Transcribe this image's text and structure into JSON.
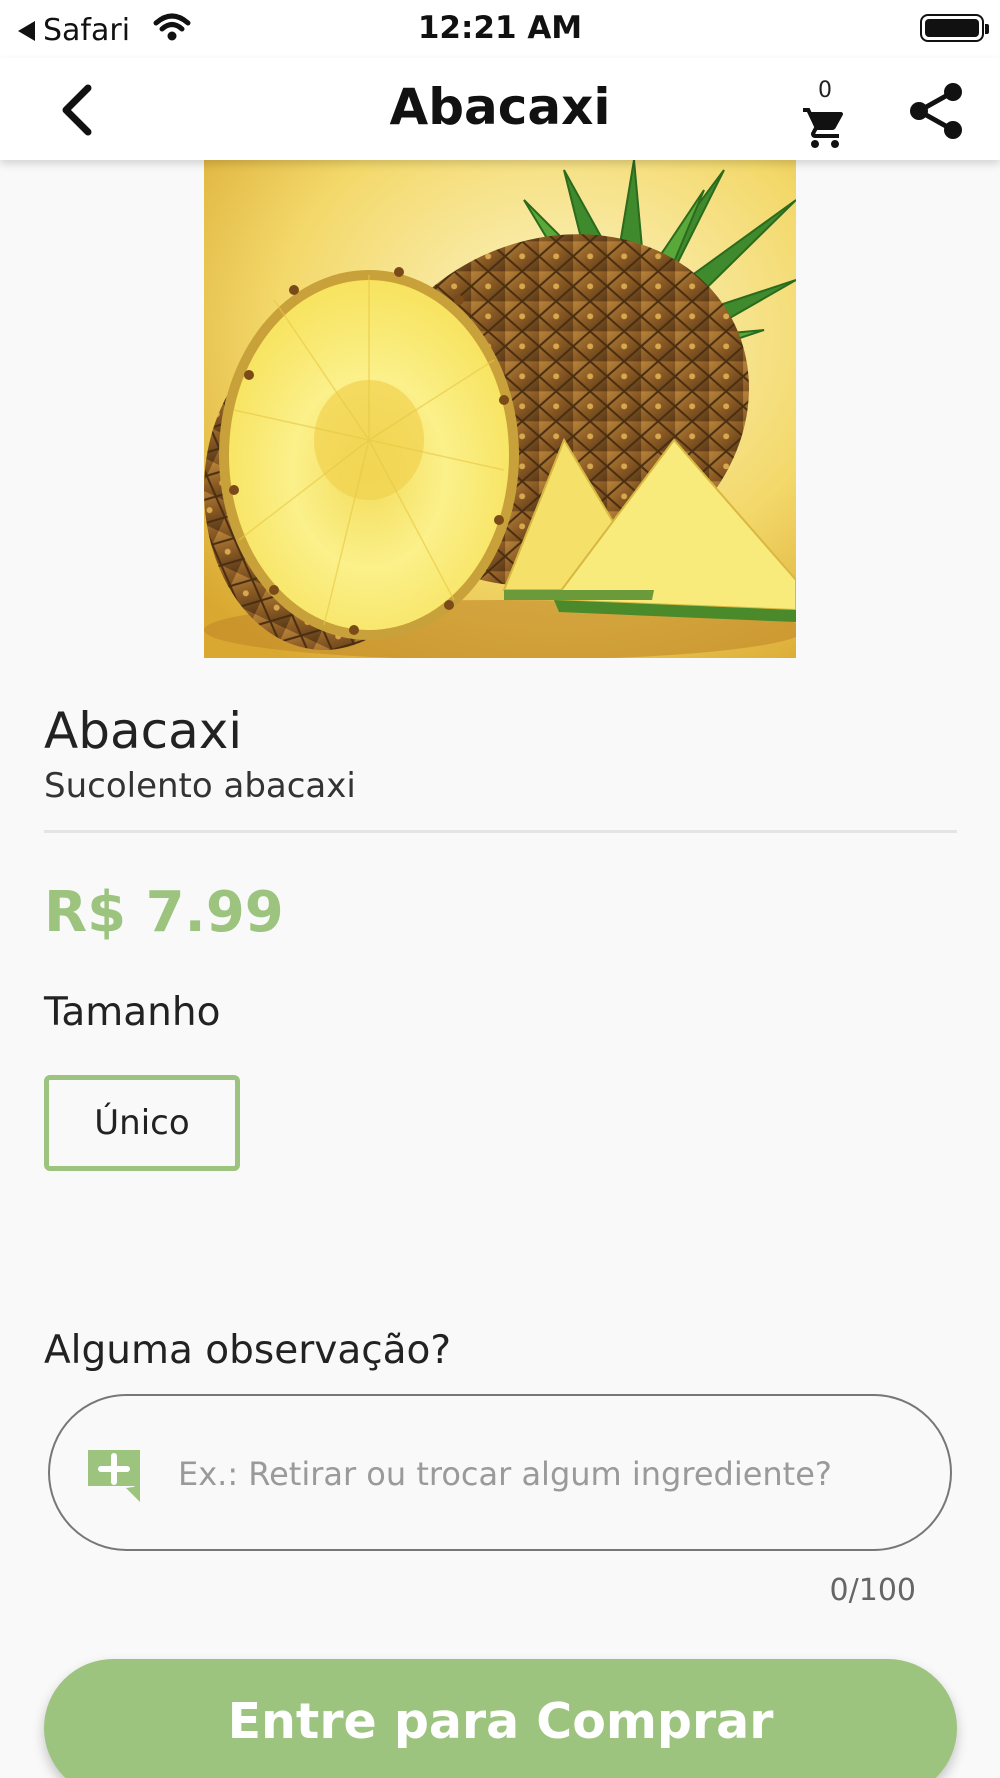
{
  "status_bar": {
    "back_app": "Safari",
    "time": "12:21 AM"
  },
  "app_bar": {
    "title": "Abacaxi",
    "cart_count": "0",
    "icons": [
      "chevron-left-icon",
      "cart-icon",
      "share-icon"
    ]
  },
  "product": {
    "image_alt": "pineapple",
    "name": "Abacaxi",
    "description": "Sucolento abacaxi",
    "price": "R$ 7.99"
  },
  "size": {
    "label": "Tamanho",
    "options": [
      "Único"
    ],
    "selected": "Único"
  },
  "note": {
    "label": "Alguma observação?",
    "placeholder": "Ex.: Retirar ou trocar algum ingrediente?",
    "value": "",
    "counter": "0/100"
  },
  "buy_button": {
    "label": "Entre para Comprar"
  },
  "colors": {
    "accent": "#9cc47f",
    "background": "#f9f9f9",
    "text": "#222222"
  }
}
